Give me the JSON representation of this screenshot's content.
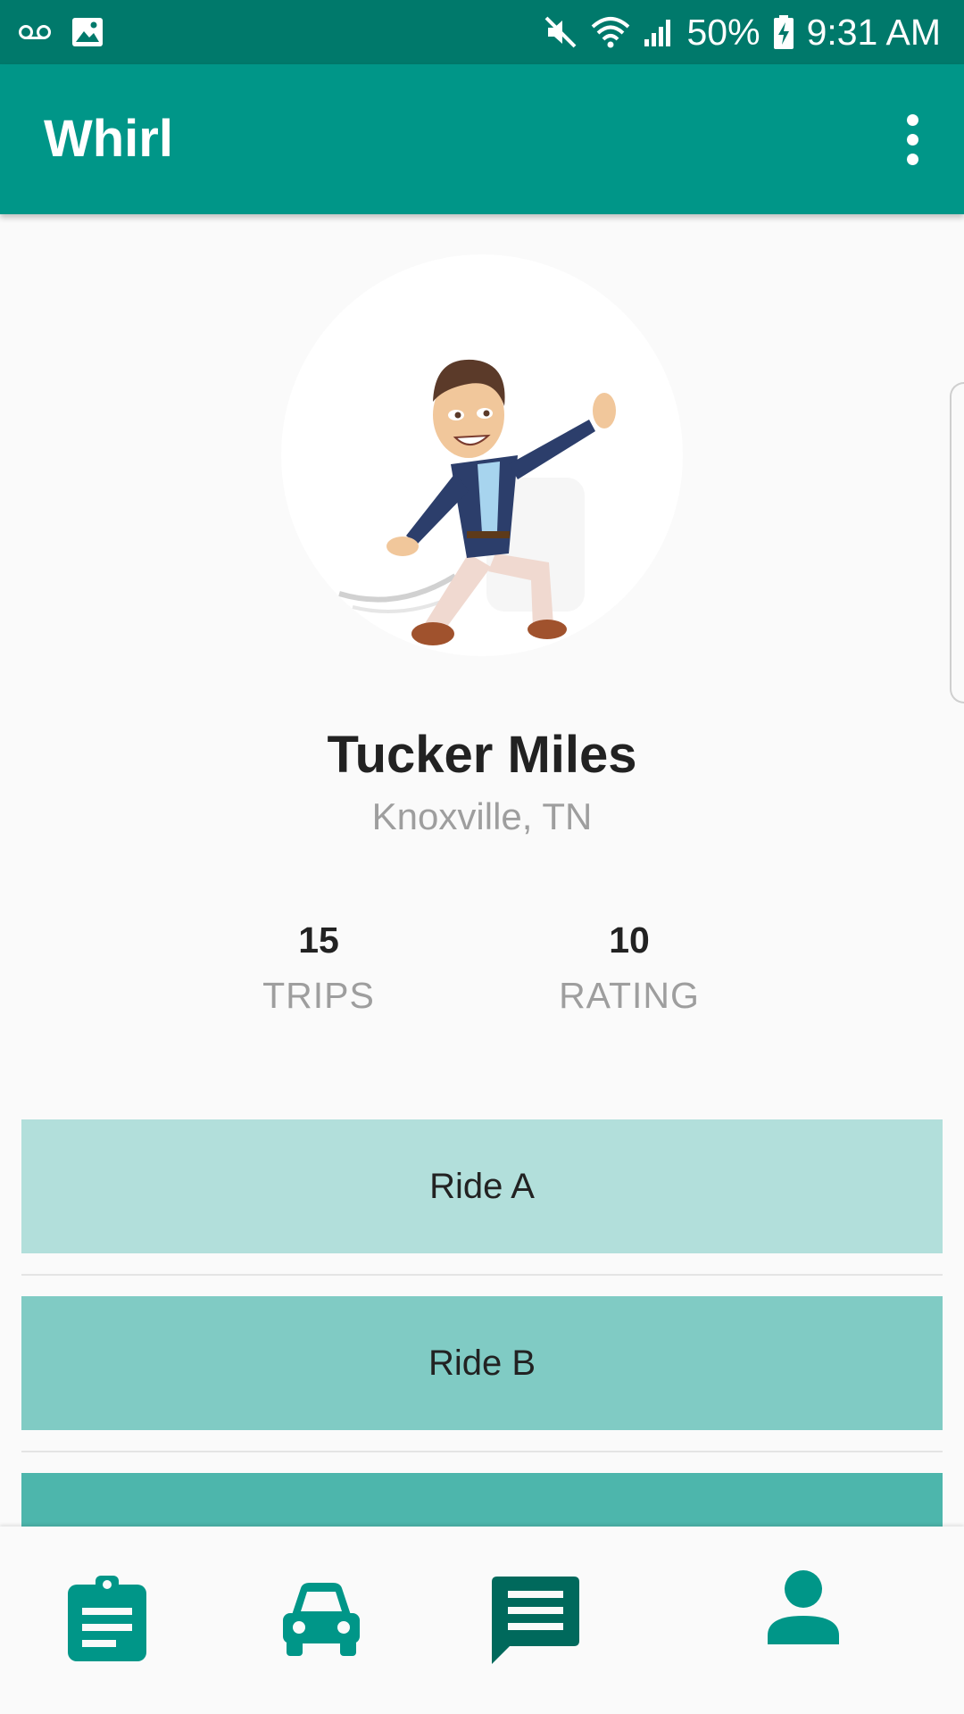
{
  "status_bar": {
    "left_icons": [
      "voicemail-icon",
      "image-icon"
    ],
    "right_icons": [
      "mute-icon",
      "wifi-icon",
      "signal-icon",
      "battery-charging-icon"
    ],
    "battery": "50%",
    "time": "9:31 AM"
  },
  "app_bar": {
    "title": "Whirl",
    "menu_icon": "more-vert-icon"
  },
  "profile": {
    "name": "Tucker Miles",
    "location": "Knoxville, TN",
    "stats": [
      {
        "value": "15",
        "label": "TRIPS"
      },
      {
        "value": "10",
        "label": "RATING"
      }
    ]
  },
  "rides": [
    {
      "label": "Ride A",
      "color": "#b2dfdb"
    },
    {
      "label": "Ride B",
      "color": "#80cbc4"
    },
    {
      "label": "",
      "color": "#4db6ac"
    }
  ],
  "bottom_nav": {
    "items": [
      {
        "icon": "assignment-icon",
        "active": false
      },
      {
        "icon": "car-icon",
        "active": false
      },
      {
        "icon": "message-icon",
        "active": true
      },
      {
        "icon": "person-icon",
        "active": false
      }
    ]
  },
  "colors": {
    "primary": "#009688",
    "primary_dark": "#00796b",
    "nav_active": "#00695c",
    "text_primary": "#222222",
    "text_secondary": "#9e9e9e"
  }
}
